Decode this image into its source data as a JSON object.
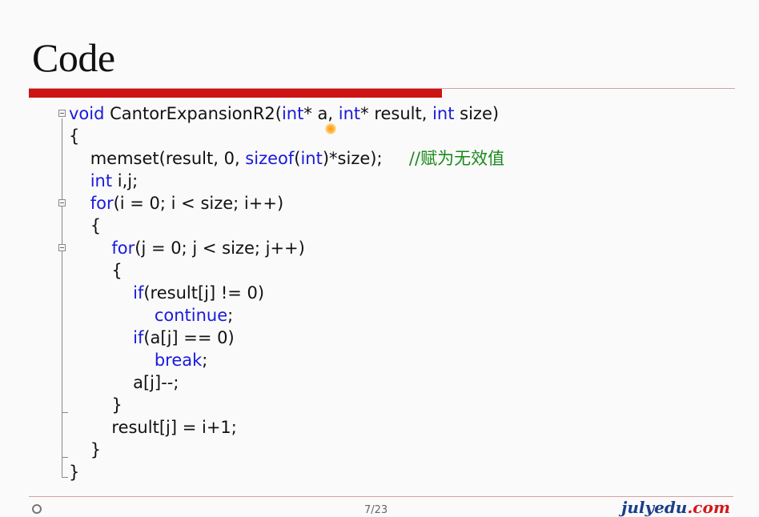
{
  "slide": {
    "title": "Code"
  },
  "code_lines": [
    [
      [
        "kw",
        "void"
      ],
      [
        "t",
        " CantorExpansionR2("
      ],
      [
        "kw",
        "int"
      ],
      [
        "t",
        "* a, "
      ],
      [
        "kw",
        "int"
      ],
      [
        "t",
        "* result, "
      ],
      [
        "kw",
        "int"
      ],
      [
        "t",
        " size)"
      ]
    ],
    [
      [
        "t",
        "{"
      ]
    ],
    [
      [
        "t",
        "    memset(result, 0, "
      ],
      [
        "kw",
        "sizeof"
      ],
      [
        "t",
        "("
      ],
      [
        "kw",
        "int"
      ],
      [
        "t",
        ")*size);     "
      ],
      [
        "cm",
        "//赋为无效值"
      ]
    ],
    [
      [
        "t",
        "    "
      ],
      [
        "kw",
        "int"
      ],
      [
        "t",
        " i,j;"
      ]
    ],
    [
      [
        "t",
        "    "
      ],
      [
        "kw",
        "for"
      ],
      [
        "t",
        "(i = 0; i < size; i++)"
      ]
    ],
    [
      [
        "t",
        "    {"
      ]
    ],
    [
      [
        "t",
        "        "
      ],
      [
        "kw",
        "for"
      ],
      [
        "t",
        "(j = 0; j < size; j++)"
      ]
    ],
    [
      [
        "t",
        "        {"
      ]
    ],
    [
      [
        "t",
        "            "
      ],
      [
        "kw",
        "if"
      ],
      [
        "t",
        "(result[j] != 0)"
      ]
    ],
    [
      [
        "t",
        "                "
      ],
      [
        "kw",
        "continue"
      ],
      [
        "t",
        ";"
      ]
    ],
    [
      [
        "t",
        "            "
      ],
      [
        "kw",
        "if"
      ],
      [
        "t",
        "(a[j] == 0)"
      ]
    ],
    [
      [
        "t",
        "                "
      ],
      [
        "kw",
        "break"
      ],
      [
        "t",
        ";"
      ]
    ],
    [
      [
        "t",
        "            a[j]--;"
      ]
    ],
    [
      [
        "t",
        "        }"
      ]
    ],
    [
      [
        "t",
        "        result[j] = i+1;"
      ]
    ],
    [
      [
        "t",
        "    }"
      ]
    ],
    [
      [
        "t",
        "}"
      ]
    ]
  ],
  "footer": {
    "left_text": "",
    "page": "7/23",
    "brand_main": "julyedu",
    "brand_suffix": ".com"
  },
  "colors": {
    "keyword": "#1a1adc",
    "comment": "#1a8a1a",
    "title_rule": "#cc1414"
  }
}
